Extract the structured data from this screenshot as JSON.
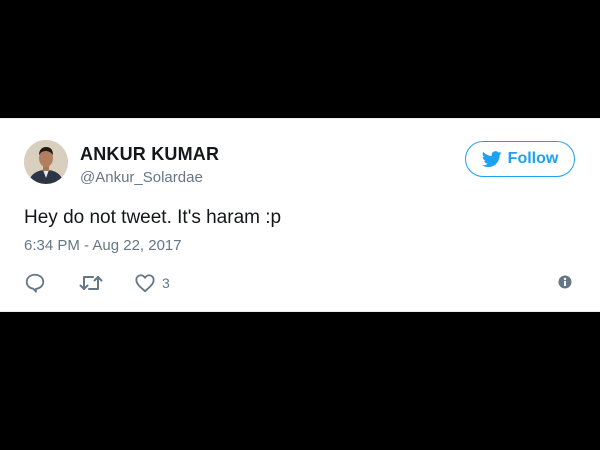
{
  "tweet": {
    "author_name": "ANKUR KUMAR",
    "author_handle": "@Ankur_Solardae",
    "follow_label": "Follow",
    "text": "Hey do not tweet. It's haram :p",
    "timestamp": "6:34 PM - Aug 22, 2017",
    "like_count": "3"
  },
  "icons": {
    "follow": "bird-icon",
    "reply": "reply-icon",
    "retweet": "retweet-icon",
    "like": "heart-icon",
    "info": "info-icon"
  },
  "colors": {
    "brand": "#1da1f2",
    "text": "#14171a",
    "muted": "#657786",
    "background": "#000000"
  }
}
